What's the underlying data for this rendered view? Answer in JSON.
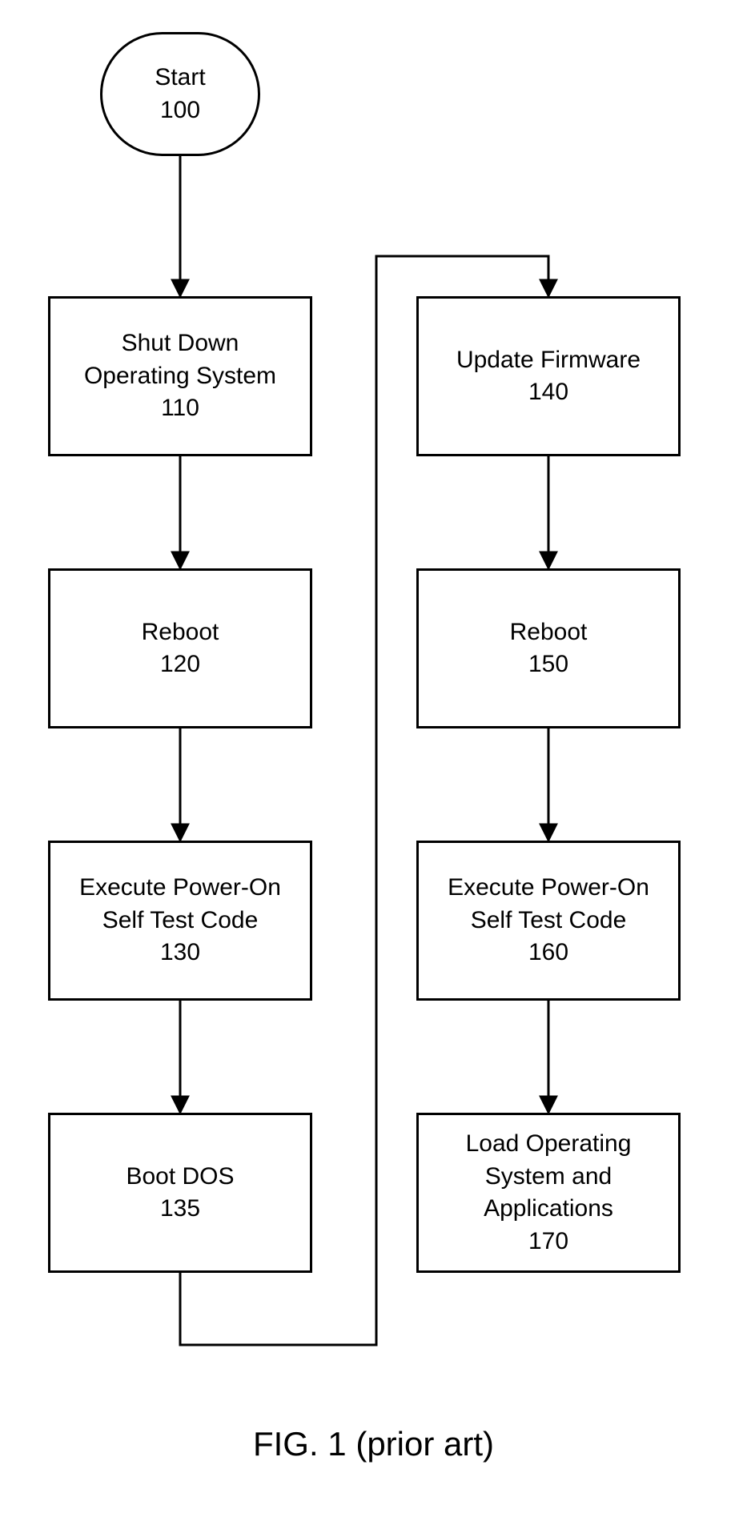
{
  "nodes": {
    "start": {
      "label": "Start",
      "num": "100"
    },
    "n110": {
      "label": "Shut Down\nOperating System",
      "num": "110"
    },
    "n120": {
      "label": "Reboot",
      "num": "120"
    },
    "n130": {
      "label": "Execute Power-On\nSelf Test Code",
      "num": "130"
    },
    "n135": {
      "label": "Boot DOS",
      "num": "135"
    },
    "n140": {
      "label": "Update Firmware",
      "num": "140"
    },
    "n150": {
      "label": "Reboot",
      "num": "150"
    },
    "n160": {
      "label": "Execute Power-On\nSelf Test Code",
      "num": "160"
    },
    "n170": {
      "label": "Load Operating\nSystem and\nApplications",
      "num": "170"
    }
  },
  "caption": "FIG. 1 (prior art)"
}
